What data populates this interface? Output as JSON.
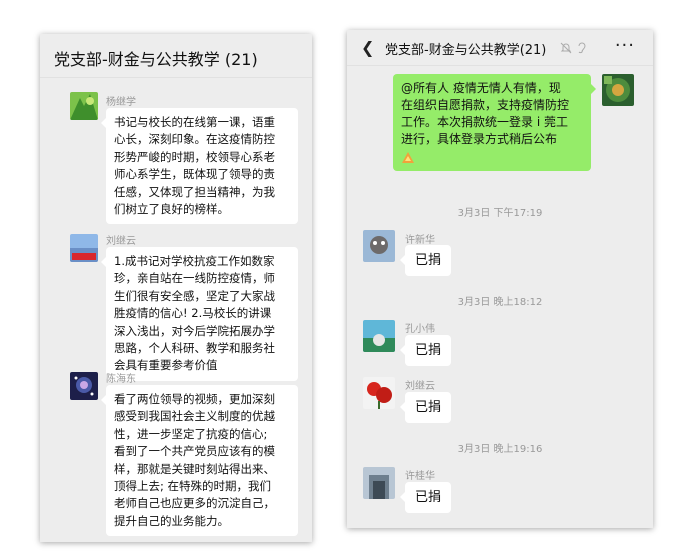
{
  "left_chat": {
    "title": "党支部-财金与公共教学 (21)",
    "messages": [
      {
        "sender": "杨继学",
        "lines": [
          "书记与校长的在线第一课，语重",
          "心长，深刻印象。在这疫情防控",
          "形势严峻的时期，校领导心系老",
          "师心系学生，既体现了领导的责",
          "任感，又体现了担当精神，为我",
          "们树立了良好的榜样。"
        ]
      },
      {
        "sender": "刘继云",
        "lines": [
          "1.成书记对学校抗疫工作如数家",
          "珍，亲自站在一线防控疫情，师",
          "生们很有安全感，坚定了大家战",
          "胜疫情的信心! 2.马校长的讲课",
          "深入浅出，对今后学院拓展办学",
          "思路，个人科研、教学和服务社",
          "会具有重要参考价值"
        ]
      },
      {
        "sender": "陈海东",
        "lines": [
          "看了两位领导的视频，更加深刻",
          "感受到我国社会主义制度的优越",
          "性，进一步坚定了抗疫的信心;",
          "看到了一个共产党员应该有的模",
          "样，那就是关键时刻站得出来、",
          "顶得上去; 在特殊的时期，我们",
          "老师自己也应更多的沉淀自己，",
          "提升自己的业务能力。"
        ]
      }
    ]
  },
  "right_chat": {
    "title": "党支部-财金与公共教学(21)",
    "outgoing": {
      "lines": [
        "@所有人 疫情无情人有情，现",
        "在组织自愿捐款，支持疫情防控",
        "工作。本次捐款统一登录 i 莞工",
        "进行，具体登录方式稍后公布"
      ]
    },
    "items": [
      {
        "time": "3月3日 下午17:19",
        "sender": "许新华",
        "text": "已捐"
      },
      {
        "time": "3月3日 晚上18:12",
        "sender": "孔小伟",
        "text": "已捐"
      },
      {
        "time": "",
        "sender": "刘继云",
        "text": "已捐"
      },
      {
        "time": "3月3日 晚上19:16",
        "sender": "许桂华",
        "text": "已捐"
      }
    ]
  },
  "icons": [
    "back-icon",
    "mute-icon",
    "ear-icon",
    "more-icon"
  ]
}
